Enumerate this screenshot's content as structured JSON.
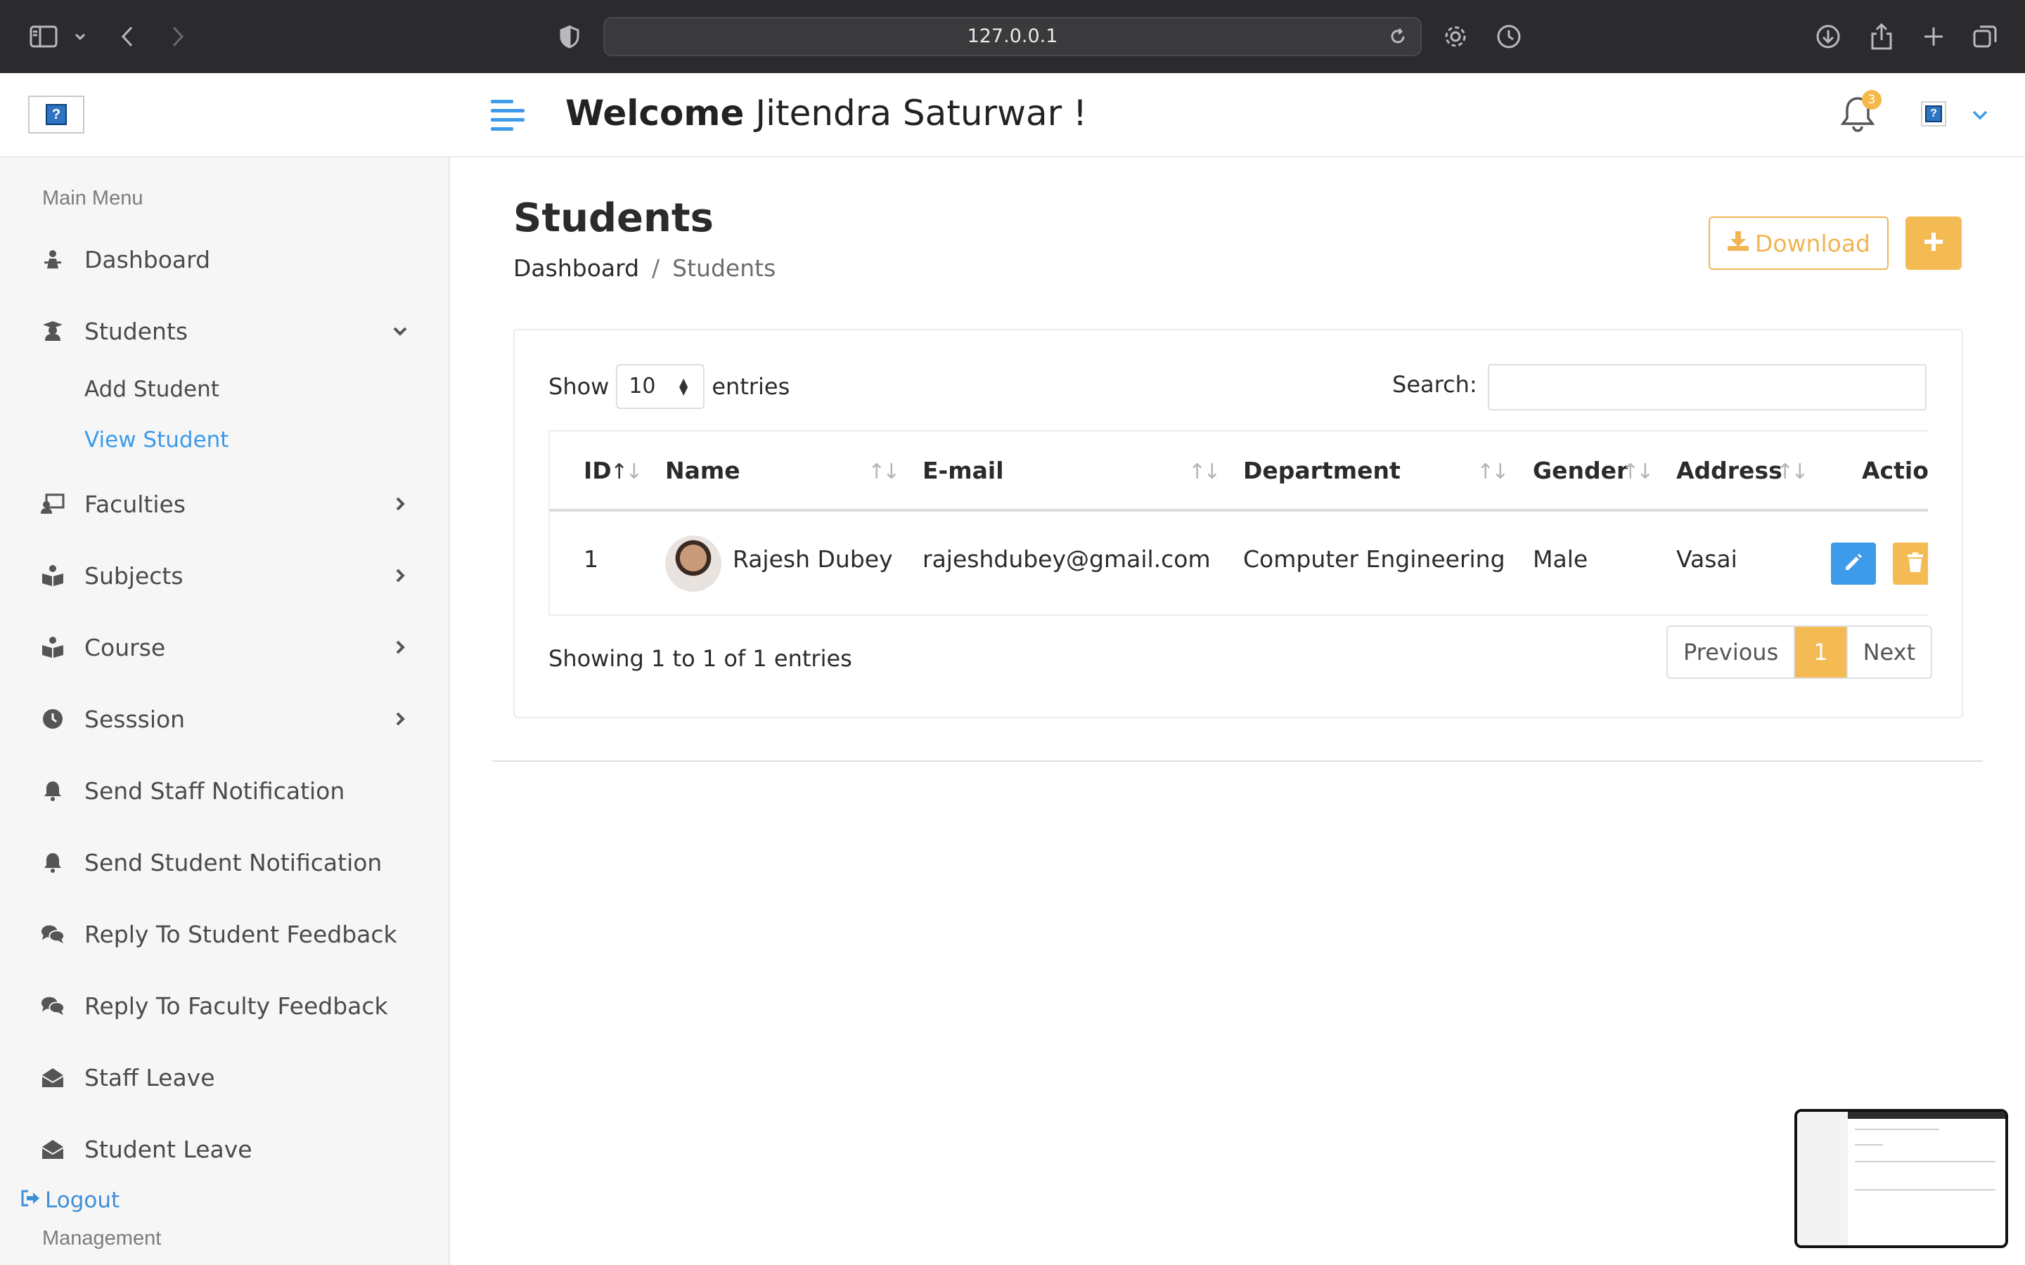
{
  "browser": {
    "url": "127.0.0.1"
  },
  "sidebar": {
    "main_menu_title": "Main Menu",
    "items": [
      {
        "label": "Dashboard",
        "icon": "dashboard-icon"
      },
      {
        "label": "Students",
        "icon": "graduate-icon",
        "expanded": true
      },
      {
        "label": "Faculties",
        "icon": "teacher-icon"
      },
      {
        "label": "Subjects",
        "icon": "book-reader-icon"
      },
      {
        "label": "Course",
        "icon": "book-reader-icon"
      },
      {
        "label": "Sesssion",
        "icon": "clock-icon"
      },
      {
        "label": "Send Staff Notification",
        "icon": "bell-icon"
      },
      {
        "label": "Send Student Notification",
        "icon": "bell-icon"
      },
      {
        "label": "Reply To Student Feedback",
        "icon": "comments-icon"
      },
      {
        "label": "Reply To Faculty Feedback",
        "icon": "comments-icon"
      },
      {
        "label": "Staff Leave",
        "icon": "envelope-open-icon"
      },
      {
        "label": "Student Leave",
        "icon": "envelope-open-icon"
      }
    ],
    "students_submenu": [
      "Add Student",
      "View Student"
    ],
    "active_submenu": "View Student",
    "logout_label": "Logout",
    "management_title": "Management"
  },
  "header": {
    "welcome_bold": "Welcome",
    "welcome_name": "Jitendra Saturwar  !",
    "notification_count": "3"
  },
  "page": {
    "title": "Students",
    "breadcrumb_home": "Dashboard",
    "breadcrumb_sep": "/",
    "breadcrumb_current": "Students",
    "download_label": "Download",
    "add_icon": "plus-icon"
  },
  "table": {
    "show_label": "Show",
    "entries_value": "10",
    "entries_label": "entries",
    "search_label": "Search:",
    "search_value": "",
    "columns": [
      "ID",
      "Name",
      "E-mail",
      "Department",
      "Gender",
      "Address",
      "Action"
    ],
    "rows": [
      {
        "id": "1",
        "name": "Rajesh Dubey",
        "email": "rajeshdubey@gmail.com",
        "department": "Computer Engineering",
        "gender": "Male",
        "address": "Vasai"
      }
    ],
    "info": "Showing 1 to 1 of 1 entries",
    "pagination": {
      "previous": "Previous",
      "current": "1",
      "next": "Next"
    }
  },
  "colors": {
    "accent_orange": "#f4bb55",
    "accent_blue": "#3d9be9",
    "sidebar_bg": "#f6f6f6",
    "chrome_bg": "#2b2b2d"
  }
}
